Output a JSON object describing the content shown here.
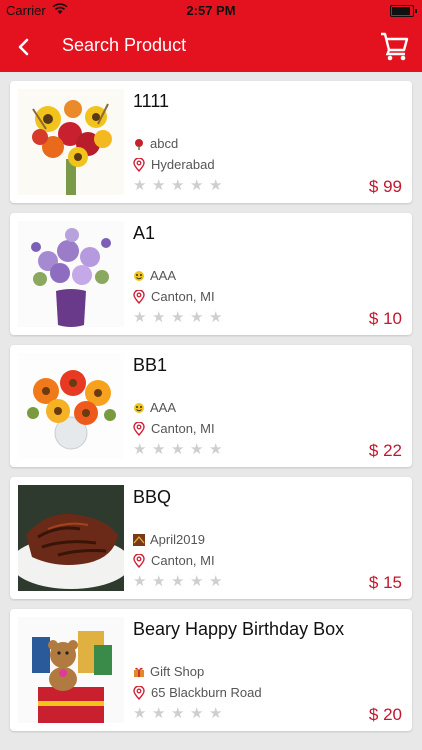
{
  "status": {
    "carrier": "Carrier",
    "time": "2:57 PM"
  },
  "nav": {
    "title": "Search Product"
  },
  "products": [
    {
      "name": "1111",
      "shop": "abcd",
      "location": "Hyderabad",
      "price": "$ 99",
      "rating": 0,
      "image": "sunflower-bouquet"
    },
    {
      "name": "A1",
      "shop": "AAA",
      "location": "Canton, MI",
      "price": "$ 10",
      "rating": 0,
      "image": "purple-flowers-vase"
    },
    {
      "name": "BB1",
      "shop": "AAA",
      "location": "Canton, MI",
      "price": "$ 22",
      "rating": 0,
      "image": "gerbera-bouquet"
    },
    {
      "name": "BBQ",
      "shop": "April2019",
      "location": "Canton, MI",
      "price": "$ 15",
      "rating": 0,
      "image": "bbq-ribs"
    },
    {
      "name": "Beary Happy Birthday Box",
      "shop": "Gift Shop",
      "location": "65 Blackburn Road",
      "price": "$ 20",
      "rating": 0,
      "image": "teddy-gift-box"
    }
  ],
  "colors": {
    "brand_red": "#e4121f",
    "price_red": "#c4172d",
    "star_empty": "#cfcfcf"
  }
}
